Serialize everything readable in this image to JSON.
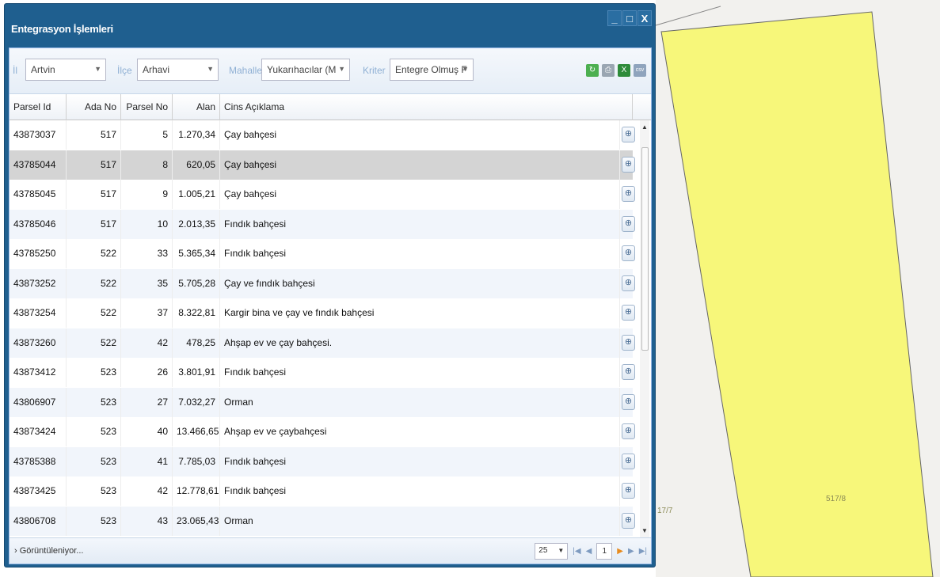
{
  "window": {
    "title": "Entegrasyon İşlemleri",
    "controls": {
      "minimize": "_",
      "maximize": "□",
      "close": "X"
    }
  },
  "toolbar": {
    "il_label": "İl",
    "il_value": "Artvin",
    "ilce_label": "İlçe",
    "ilce_value": "Arhavi",
    "mahalle_label": "Mahalle",
    "mahalle_value": "Yukarıhacılar (M",
    "kriter_label": "Kriter",
    "kriter_value": "Entegre Olmuş F",
    "icons": [
      "refresh-icon",
      "print-icon",
      "excel-export-icon",
      "csv-export-icon"
    ]
  },
  "grid": {
    "columns": [
      "Parsel Id",
      "Ada No",
      "Parsel No",
      "Alan",
      "Cins Açıklama"
    ],
    "selected_row": 1,
    "rows": [
      [
        "43873037",
        "517",
        "5",
        "1.270,34",
        "Çay bahçesi"
      ],
      [
        "43785044",
        "517",
        "8",
        "620,05",
        "Çay bahçesi"
      ],
      [
        "43785045",
        "517",
        "9",
        "1.005,21",
        "Çay bahçesi"
      ],
      [
        "43785046",
        "517",
        "10",
        "2.013,35",
        "Fındık bahçesi"
      ],
      [
        "43785250",
        "522",
        "33",
        "5.365,34",
        "Fındık bahçesi"
      ],
      [
        "43873252",
        "522",
        "35",
        "5.705,28",
        "Çay ve fındık bahçesi"
      ],
      [
        "43873254",
        "522",
        "37",
        "8.322,81",
        "Kargir bina ve çay ve fındık bahçesi"
      ],
      [
        "43873260",
        "522",
        "42",
        "478,25",
        "Ahşap ev ve çay bahçesi."
      ],
      [
        "43873412",
        "523",
        "26",
        "3.801,91",
        "Fındık bahçesi"
      ],
      [
        "43806907",
        "523",
        "27",
        "7.032,27",
        "Orman"
      ],
      [
        "43873424",
        "523",
        "40",
        "13.466,65",
        "Ahşap ev ve çaybahçesi"
      ],
      [
        "43785388",
        "523",
        "41",
        "7.785,03",
        "Fındık bahçesi"
      ],
      [
        "43873425",
        "523",
        "42",
        "12.778,61",
        "Fındık bahçesi"
      ],
      [
        "43806708",
        "523",
        "43",
        "23.065,43",
        "Orman"
      ]
    ]
  },
  "footer": {
    "status": "› Görüntüleniyor...",
    "page_size": "25",
    "page": "1"
  },
  "map": {
    "parcel_label": "517/8",
    "neighbor_label": "17/7",
    "parcel_color": "#f7f77a",
    "background_color": "#f2f1ee"
  }
}
